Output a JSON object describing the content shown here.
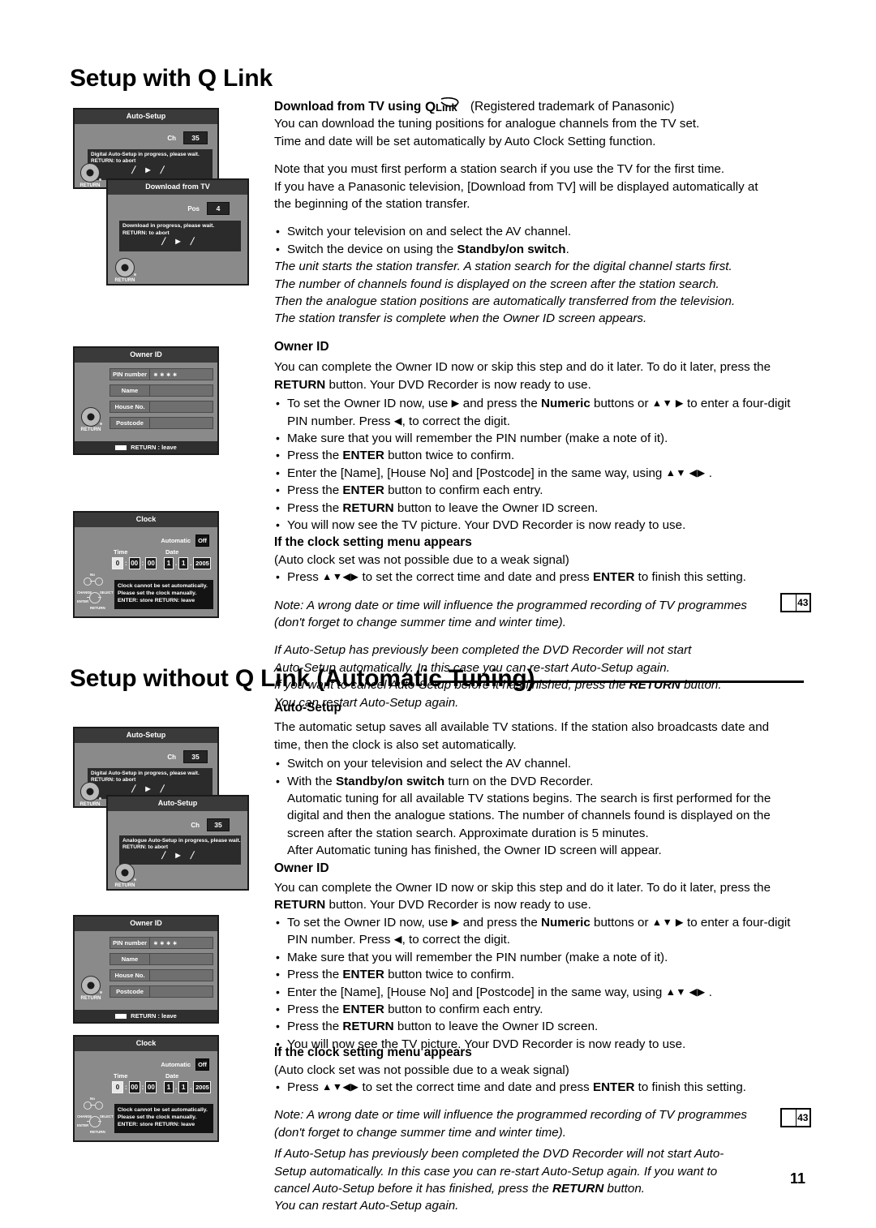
{
  "page": {
    "number": "11"
  },
  "sections": [
    {
      "id": "with-qlink",
      "heading": "Setup with Q Link",
      "blocks": {
        "download_heading_prefix": "Download from TV using",
        "download_heading_suffix": "(Registered trademark of Panasonic)",
        "intro_line1": "You can download the tuning positions for analogue channels from the TV set.",
        "intro_line2": "Time and date will be set automatically by Auto Clock Setting function.",
        "note_line1": "Note that you must first perform a station search if you use the TV for the first time.",
        "note_line2": "If you have a Panasonic television, [Download from TV] will be displayed automatically at",
        "note_line3": "the beginning of the station transfer.",
        "bullets": [
          "Switch your television on and select the AV channel.",
          "Switch the device on using the Standby/on switch."
        ],
        "bullet2_plain_pre": "Switch the device on using the ",
        "bullet2_bold": "Standby/on switch",
        "bullet2_plain_post": ".",
        "italic_lines": [
          "The unit starts the station transfer. A station search for the digital channel starts first.",
          "The number of channels found is displayed on the screen after the station search.",
          "Then the analogue station positions are automatically transferred from the television.",
          "The station transfer is complete when the Owner ID screen appears."
        ],
        "owner_id_heading": "Owner ID",
        "owner_id_intro_pre": "You can complete the Owner ID now or skip this step and do it later. To do it later, press the ",
        "owner_id_intro_bold": "RETURN",
        "owner_id_intro_post": " button. Your DVD Recorder is now ready to use.",
        "owner_bullets": {
          "b1_pre": "To set the Owner ID now, use ",
          "b1_arrow1": "▶",
          "b1_mid": " and press the ",
          "b1_bold": "Numeric",
          "b1_mid2": " buttons or ",
          "b1_arrow2": "▲▼ ▶",
          "b1_post": " to enter a four-digit PIN number. Press ",
          "b1_arrow3": "◀",
          "b1_end": ", to correct the digit.",
          "b2": "Make sure that you will remember the PIN number (make a note of it).",
          "b3_pre": "Press the ",
          "b3_bold": "ENTER",
          "b3_post": " button twice to confirm.",
          "b4_pre": "Enter the [Name], [House No] and [Postcode] in the same way, using ",
          "b4_arrows": "▲▼ ◀▶",
          "b4_post": " .",
          "b5_pre": "Press the ",
          "b5_bold": "ENTER",
          "b5_post": " button to confirm each entry.",
          "b6_pre": "Press the ",
          "b6_bold": "RETURN",
          "b6_post": " button to leave the Owner ID screen.",
          "b7": "You will now see the TV picture. Your DVD Recorder is now ready to use."
        },
        "clock_heading": "If the clock setting menu appears",
        "clock_sub": "(Auto clock set was not possible due to a weak signal)",
        "clock_bullet_pre": "Press ",
        "clock_bullet_arrows": "▲▼◀▶",
        "clock_bullet_mid": " to set the correct time and date and press ",
        "clock_bullet_bold": "ENTER",
        "clock_bullet_post": " to finish this setting.",
        "note_italic_1": "Note: A wrong date or time will influence the programmed recording of TV programmes",
        "note_italic_2": "(don't forget to change summer time and winter time).",
        "restart_lines_pre": [
          "If Auto-Setup has previously been completed the DVD Recorder will not start",
          "Auto-Setup automatically. In this case you can re-start Auto-Setup again."
        ],
        "restart_line3_pre": "If you want to cancel Auto-Setup before it has finished, press the ",
        "restart_line3_bold": "RETURN",
        "restart_line3_post": " button.",
        "restart_line4": "You can restart Auto-Setup again.",
        "page_ref": "43"
      }
    },
    {
      "id": "without-qlink",
      "heading": "Setup without Q Link (Automatic Tuning)",
      "blocks": {
        "auto_setup_heading": "Auto-Setup",
        "auto_setup_line1": "The automatic setup saves all available TV stations. If the station also broadcasts date and",
        "auto_setup_line2": "time, then the clock is also set automatically.",
        "b1": "Switch on your television and select the AV channel.",
        "b2_pre": "With the ",
        "b2_bold": "Standby/on switch",
        "b2_post": " turn on the DVD Recorder.",
        "b2_cont": [
          "Automatic tuning for all available TV stations begins. The search is first performed for the",
          "digital and then the analogue stations. The number of channels found is displayed on the",
          "screen after the station search. Approximate duration is 5 minutes.",
          "After Automatic tuning has finished, the Owner ID screen will appear."
        ],
        "owner_id_heading": "Owner ID",
        "owner_id_intro_pre": "You can complete the Owner ID now or skip this step and do it later. To do it later, press the ",
        "owner_id_intro_bold": "RETURN",
        "owner_id_intro_post": " button. Your DVD Recorder is now ready to use.",
        "owner_bullets": {
          "b1_pre": "To set the Owner ID now, use ",
          "b1_arrow1": "▶",
          "b1_mid": " and press the ",
          "b1_bold": "Numeric",
          "b1_mid2": " buttons or ",
          "b1_arrow2": "▲▼ ▶",
          "b1_post": " to enter a four-digit PIN number. Press ",
          "b1_arrow3": "◀",
          "b1_end": ", to correct the digit.",
          "b2": "Make sure that you will remember the PIN number (make a note of it).",
          "b3_pre": "Press the ",
          "b3_bold": "ENTER",
          "b3_post": " button twice to confirm.",
          "b4_pre": "Enter the [Name], [House No] and [Postcode] in the same way, using ",
          "b4_arrows": "▲▼ ◀▶",
          "b4_post": " .",
          "b5_pre": "Press the ",
          "b5_bold": "ENTER",
          "b5_post": " button to confirm each entry.",
          "b6_pre": "Press the ",
          "b6_bold": "RETURN",
          "b6_post": " button to leave the Owner ID screen.",
          "b7": "You will now see the TV picture. Your DVD Recorder is now ready to use."
        },
        "clock_heading": "If the clock setting menu appears",
        "clock_sub": "(Auto clock set was not possible due to a weak signal)",
        "clock_bullet_pre": "Press ",
        "clock_bullet_arrows": "▲▼◀▶",
        "clock_bullet_mid": " to set the correct time and date and press ",
        "clock_bullet_bold": "ENTER",
        "clock_bullet_post": " to finish this setting.",
        "note_italic_1": "Note: A wrong date or time will influence the programmed recording of TV programmes",
        "note_italic_2": "(don't forget to change summer time and winter time).",
        "restart_line1": "If Auto-Setup has previously been completed the DVD Recorder will not start Auto-",
        "restart_line2": "Setup automatically. In this case you can re-start Auto-Setup again. If you want to",
        "restart_line3_pre": "cancel Auto-Setup before it has finished, press the ",
        "restart_line3_bold": "RETURN",
        "restart_line3_post": " button.",
        "restart_line4": "You can restart Auto-Setup again.",
        "page_ref": "43"
      }
    }
  ],
  "screens": {
    "auto_setup_digital": {
      "title": "Auto-Setup",
      "field_label": "Ch",
      "field_value": "35",
      "message_line1": "Digital Auto-Setup in progress, please wait.",
      "message_line2": "RETURN: to abort",
      "progress": "╱ ▶ ╱",
      "nav_label": "RETURN"
    },
    "download_from_tv": {
      "title": "Download from TV",
      "field_label": "Pos",
      "field_value": "4",
      "message_line1": "Download in progress, please wait.",
      "message_line2": "RETURN: to abort",
      "progress": "╱ ▶ ╱",
      "nav_label": "RETURN"
    },
    "auto_setup_analogue": {
      "title": "Auto-Setup",
      "field_label": "Ch",
      "field_value": "35",
      "message_line1": "Analogue Auto-Setup in progress, please wait.",
      "message_line2": "RETURN: to abort",
      "progress": "╱ ▶ ╱",
      "nav_label": "RETURN"
    },
    "owner_id": {
      "title": "Owner ID",
      "fields": [
        {
          "label": "PIN number",
          "value": "∗∗∗∗"
        },
        {
          "label": "Name",
          "value": ""
        },
        {
          "label": "House No.",
          "value": ""
        },
        {
          "label": "Postcode",
          "value": ""
        }
      ],
      "nav_label": "RETURN",
      "footer": "RETURN : leave"
    },
    "clock": {
      "title": "Clock",
      "automatic_label": "Automatic",
      "automatic_value": "Off",
      "time_label": "Time",
      "date_label": "Date",
      "time_hour": "0",
      "time_min": "00",
      "time_sec": "00",
      "date_day": "1",
      "date_month": "1",
      "date_year": "2005",
      "msg_line1": "Clock cannot be set automatically.",
      "msg_line2": "Please set the clock manually.",
      "msg_line3": "ENTER: store   RETURN: leave",
      "pad_no": "No",
      "pad_change": "CHANGE",
      "pad_select": "SELECT",
      "pad_enter": "ENTER",
      "pad_return": "RETURN"
    }
  }
}
